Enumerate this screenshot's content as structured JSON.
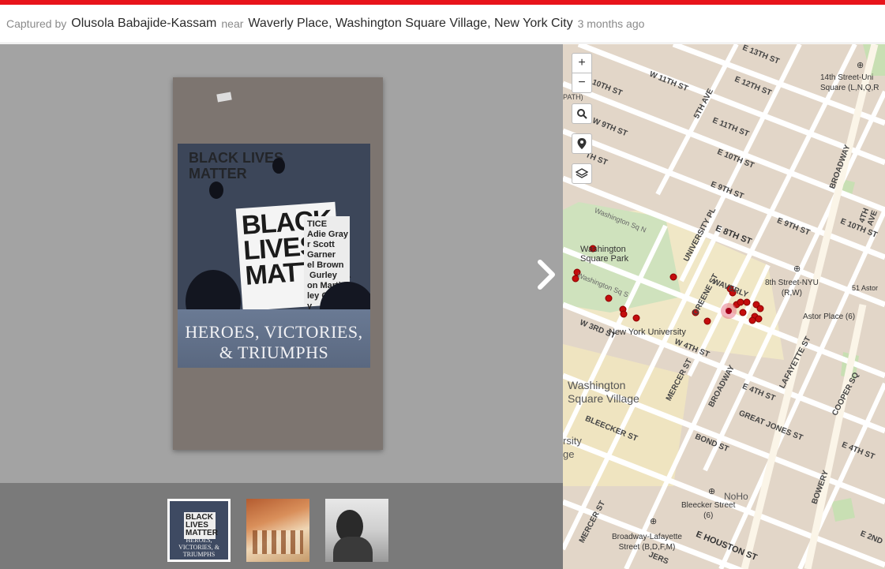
{
  "caption": {
    "captured_by_label": "Captured by",
    "author": "Olusola Babajide-Kassam",
    "near_label": "near",
    "location": "Waverly Place, Washington Square Village, New York City",
    "time_ago": "3 months ago"
  },
  "photo": {
    "wall_text": "BLACK LIVES\nMATTER",
    "sign_text": "BLACK\nLIVES\nMATTER",
    "side_sign_text": "TICE\nAdie Gray\nr Scott\nGarner\nel Brown\n Gurley\non Martin\nley Gra\ny\nn",
    "poster_caption": "HEROES, VICTORIES,\n& TRIUMPHS"
  },
  "thumbnails": [
    {
      "label": "HEROES, VICTORIES, & TRIUMPHS",
      "selected": true
    },
    {
      "label": "",
      "selected": false
    },
    {
      "label": "",
      "selected": false
    }
  ],
  "map": {
    "controls": {
      "zoom_in": "+",
      "zoom_out": "−"
    },
    "streets": {
      "e13": "E 13TH ST",
      "w11": "W 11TH ST",
      "e12": "E 12TH ST",
      "w10": "10TH ST",
      "fifth_ave": "5TH AVE",
      "w9": "W 9TH ST",
      "e11": "E 11TH ST",
      "e10": "E 10TH ST",
      "th_st": "TH ST",
      "e9": "E 9TH ST",
      "broadway_n": "BROADWAY",
      "fourth_ave": "4TH AVE",
      "wash_sq_n": "Washington Sq N",
      "univ_pl": "UNIVERSITY PL",
      "e8": "E 8TH ST",
      "e9_2": "E 9TH ST",
      "e10_2": "E 10TH ST",
      "greene": "GREENE ST",
      "waverly": "WAVERLY",
      "wash_sq_s": "Washington Sq S",
      "w3": "W 3RD ST",
      "w4": "W 4TH ST",
      "mercer": "MERCER ST",
      "broadway": "BROADWAY",
      "e4": "E 4TH ST",
      "lafayette": "LAFAYETTE ST",
      "cooper": "COOPER SQ",
      "bleecker": "BLEECKER ST",
      "bond": "BOND ST",
      "great_jones": "GREAT JONES ST",
      "e4_2": "E 4TH ST",
      "bowery": "BOWERY",
      "mercer2": "MERCER ST",
      "e_houston": "E HOUSTON ST",
      "e2": "E 2ND",
      "jers": "JERS",
      "path": "PATH)"
    },
    "places": {
      "union_sq_station": "14th Street-Uni\nSquare (L,N,Q,R",
      "washington_sq_park": "Washington\nSquare Park",
      "eighth_st_nyu": "8th Street-NYU\n(R,W)",
      "astor_place": "Astor Place (6)",
      "astor_51": "51 Astor",
      "nyu": "New York University",
      "wsv": "Washington\nSquare Village",
      "rsity": "rsity\nge",
      "noho": "NoHo",
      "bleecker_station": "Bleecker Street\n(6)",
      "broadway_lafayette": "Broadway-Lafayette\nStreet (B,D,F,M)"
    },
    "colors": {
      "marker": "#c40d0d",
      "land": "#e4dcd2",
      "park": "#d3e4c2",
      "campus": "#efe6c4"
    }
  }
}
